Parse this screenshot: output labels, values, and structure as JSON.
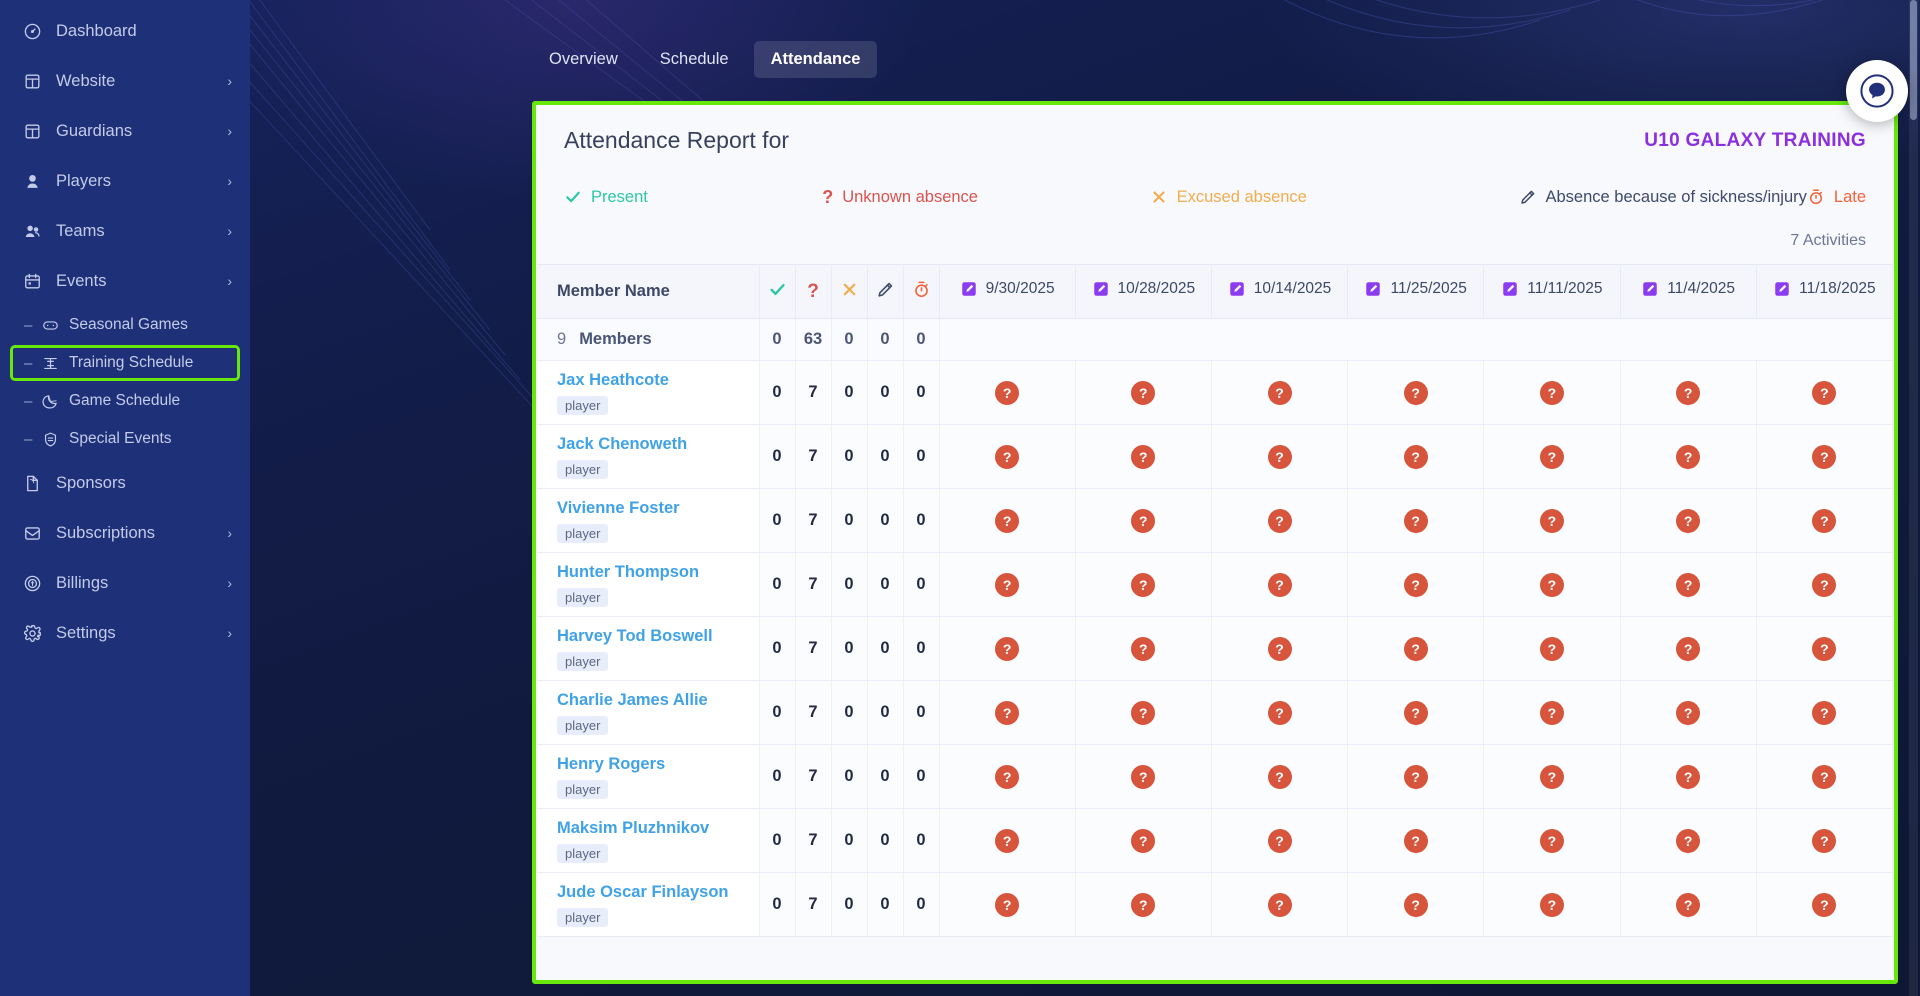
{
  "sidebar": {
    "items": [
      {
        "label": "Dashboard",
        "icon": "gauge-icon",
        "chevron": "",
        "sub": false,
        "highlighted": false
      },
      {
        "label": "Website",
        "icon": "layout-icon",
        "chevron": "›",
        "sub": false,
        "highlighted": false
      },
      {
        "label": "Guardians",
        "icon": "layout-icon",
        "chevron": "›",
        "sub": false,
        "highlighted": false
      },
      {
        "label": "Players",
        "icon": "user-icon",
        "chevron": "›",
        "sub": false,
        "highlighted": false
      },
      {
        "label": "Teams",
        "icon": "users-icon",
        "chevron": "›",
        "sub": false,
        "highlighted": false
      },
      {
        "label": "Events",
        "icon": "calendar-icon",
        "chevron": "›",
        "sub": false,
        "highlighted": false
      },
      {
        "label": "Seasonal Games",
        "icon": "gamepad-icon",
        "chevron": "",
        "sub": true,
        "highlighted": false
      },
      {
        "label": "Training Schedule",
        "icon": "training-icon",
        "chevron": "",
        "sub": true,
        "highlighted": true
      },
      {
        "label": "Game Schedule",
        "icon": "moon-icon",
        "chevron": "",
        "sub": true,
        "highlighted": false
      },
      {
        "label": "Special Events",
        "icon": "shield-icon",
        "chevron": "",
        "sub": true,
        "highlighted": false
      },
      {
        "label": "Sponsors",
        "icon": "document-icon",
        "chevron": "",
        "sub": false,
        "highlighted": false
      },
      {
        "label": "Subscriptions",
        "icon": "envelope-icon",
        "chevron": "›",
        "sub": false,
        "highlighted": false
      },
      {
        "label": "Billings",
        "icon": "coin-icon",
        "chevron": "›",
        "sub": false,
        "highlighted": false
      },
      {
        "label": "Settings",
        "icon": "gear-icon",
        "chevron": "›",
        "sub": false,
        "highlighted": false
      }
    ]
  },
  "tabs": [
    {
      "label": "Overview",
      "active": false
    },
    {
      "label": "Schedule",
      "active": false
    },
    {
      "label": "Attendance",
      "active": true
    }
  ],
  "report": {
    "title": "Attendance Report for",
    "team_name": "U10 GALAXY TRAINING",
    "activities_count": "7 Activities",
    "member_count": "9",
    "member_label": "Members"
  },
  "legend": [
    {
      "symbol": "✓",
      "label": "Present",
      "icon": "check-icon",
      "color": "#2cc7a6"
    },
    {
      "symbol": "?",
      "label": "Unknown absence",
      "icon": "question-icon",
      "color": "#d9534f"
    },
    {
      "symbol": "✕",
      "label": "Excused absence",
      "icon": "cross-icon",
      "color": "#f0ad4e"
    },
    {
      "symbol": "✎",
      "label": "Absence because of sickness/injury",
      "icon": "pencil-icon",
      "color": "#3c4a6b"
    },
    {
      "symbol": "⏱",
      "label": "Late",
      "icon": "stopwatch-icon",
      "color": "#f4623a"
    }
  ],
  "table": {
    "name_header": "Member Name",
    "stat_headers": [
      {
        "icon": "check-icon",
        "symbol": "✓",
        "color": "#2cc7a6"
      },
      {
        "icon": "question-icon",
        "symbol": "?",
        "color": "#d9534f"
      },
      {
        "icon": "cross-icon",
        "symbol": "✕",
        "color": "#f0ad4e"
      },
      {
        "icon": "pencil-icon",
        "symbol": "✎",
        "color": "#3c4a6b"
      },
      {
        "icon": "stopwatch-icon",
        "symbol": "⏱",
        "color": "#f4623a"
      }
    ],
    "date_columns": [
      "9/30/2025",
      "10/28/2025",
      "10/14/2025",
      "11/25/2025",
      "11/11/2025",
      "11/4/2025",
      "11/18/2025"
    ],
    "summary_totals": [
      "0",
      "63",
      "0",
      "0",
      "0"
    ],
    "rows": [
      {
        "name": "Jax Heathcote",
        "role": "player",
        "stats": [
          "0",
          "7",
          "0",
          "0",
          "0"
        ],
        "marks": [
          "?",
          "?",
          "?",
          "?",
          "?",
          "?",
          "?"
        ]
      },
      {
        "name": "Jack Chenoweth",
        "role": "player",
        "stats": [
          "0",
          "7",
          "0",
          "0",
          "0"
        ],
        "marks": [
          "?",
          "?",
          "?",
          "?",
          "?",
          "?",
          "?"
        ]
      },
      {
        "name": "Vivienne Foster",
        "role": "player",
        "stats": [
          "0",
          "7",
          "0",
          "0",
          "0"
        ],
        "marks": [
          "?",
          "?",
          "?",
          "?",
          "?",
          "?",
          "?"
        ]
      },
      {
        "name": "Hunter Thompson",
        "role": "player",
        "stats": [
          "0",
          "7",
          "0",
          "0",
          "0"
        ],
        "marks": [
          "?",
          "?",
          "?",
          "?",
          "?",
          "?",
          "?"
        ]
      },
      {
        "name": "Harvey Tod Boswell",
        "role": "player",
        "stats": [
          "0",
          "7",
          "0",
          "0",
          "0"
        ],
        "marks": [
          "?",
          "?",
          "?",
          "?",
          "?",
          "?",
          "?"
        ]
      },
      {
        "name": "Charlie James Allie",
        "role": "player",
        "stats": [
          "0",
          "7",
          "0",
          "0",
          "0"
        ],
        "marks": [
          "?",
          "?",
          "?",
          "?",
          "?",
          "?",
          "?"
        ]
      },
      {
        "name": "Henry Rogers",
        "role": "player",
        "stats": [
          "0",
          "7",
          "0",
          "0",
          "0"
        ],
        "marks": [
          "?",
          "?",
          "?",
          "?",
          "?",
          "?",
          "?"
        ]
      },
      {
        "name": "Maksim Pluzhnikov",
        "role": "player",
        "stats": [
          "0",
          "7",
          "0",
          "0",
          "0"
        ],
        "marks": [
          "?",
          "?",
          "?",
          "?",
          "?",
          "?",
          "?"
        ]
      },
      {
        "name": "Jude Oscar Finlayson",
        "role": "player",
        "stats": [
          "0",
          "7",
          "0",
          "0",
          "0"
        ],
        "marks": [
          "?",
          "?",
          "?",
          "?",
          "?",
          "?",
          "?"
        ]
      }
    ]
  },
  "colors": {
    "sidebar_bg": "#1e3078",
    "highlight_green": "#67e80a",
    "team_purple": "#8b2fe0",
    "player_link": "#3fa2e8",
    "mark_red": "#d6553c",
    "date_icon_purple": "#8b3cf0"
  },
  "chat_widget": {
    "icon": "chat-bubble-icon"
  }
}
